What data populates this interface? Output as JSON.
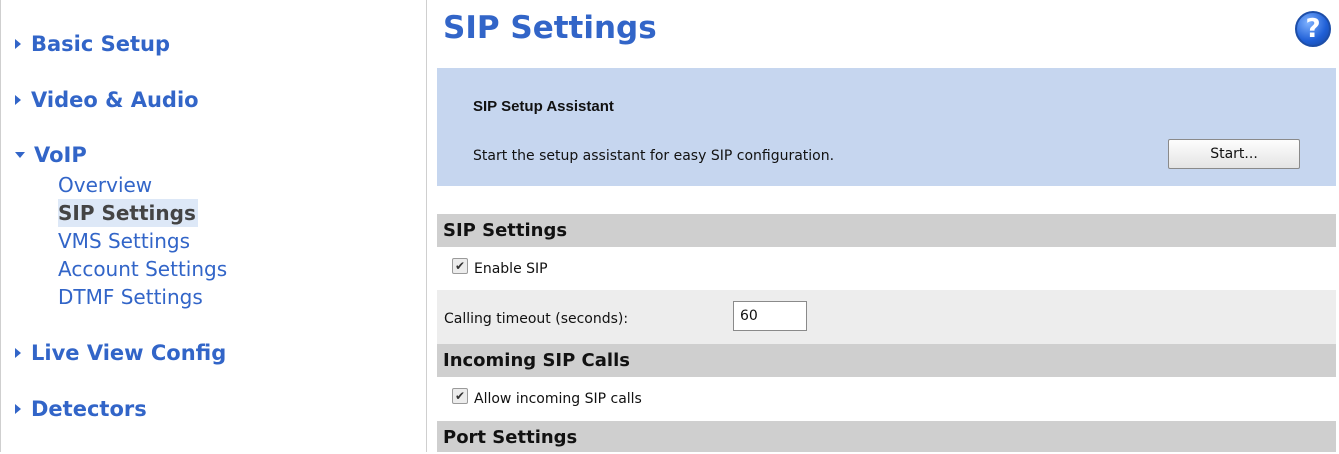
{
  "sidebar": {
    "sections": [
      {
        "label": "Basic Setup",
        "icon": "triangle-right-icon"
      },
      {
        "label": "Video & Audio",
        "icon": "triangle-right-icon"
      },
      {
        "label": "VoIP",
        "icon": "triangle-down-icon"
      },
      {
        "label": "Live View Config",
        "icon": "triangle-right-icon"
      },
      {
        "label": "Detectors",
        "icon": "triangle-right-icon"
      }
    ],
    "voip_items": [
      {
        "label": "Overview"
      },
      {
        "label": "SIP Settings",
        "active": true
      },
      {
        "label": "VMS Settings"
      },
      {
        "label": "Account Settings"
      },
      {
        "label": "DTMF Settings"
      }
    ]
  },
  "main": {
    "title": "SIP Settings",
    "help_icon": "?",
    "assistant": {
      "title": "SIP Setup Assistant",
      "description": "Start the setup assistant for easy SIP configuration.",
      "start_label": "Start..."
    },
    "sip_settings": {
      "header": "SIP Settings",
      "enable_sip_label": "Enable SIP",
      "enable_sip_checked": true,
      "timeout_label": "Calling timeout (seconds):",
      "timeout_value": "60"
    },
    "incoming": {
      "header": "Incoming SIP Calls",
      "allow_label": "Allow incoming SIP calls",
      "allow_checked": true
    },
    "port": {
      "header": "Port Settings"
    }
  },
  "colors": {
    "link": "#3265c8",
    "assistant_bg": "#c6d6ef",
    "section_header_bg": "#cfcfcf"
  }
}
